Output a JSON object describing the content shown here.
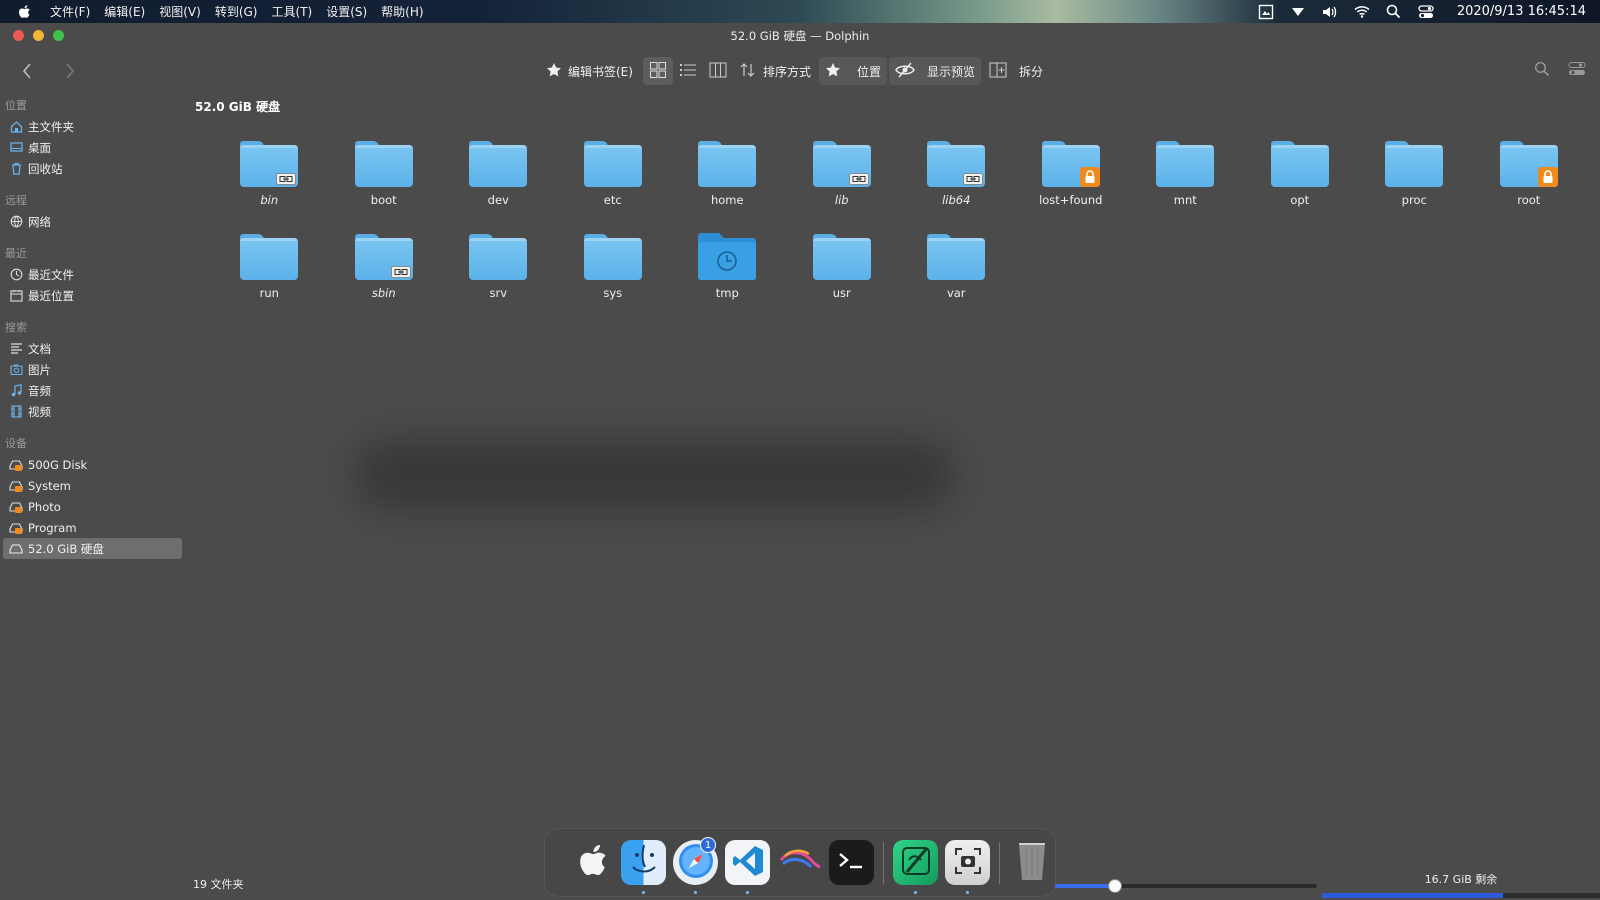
{
  "menubar": {
    "items": [
      "文件(F)",
      "编辑(E)",
      "视图(V)",
      "转到(G)",
      "工具(T)",
      "设置(S)",
      "帮助(H)"
    ],
    "clock": "2020/9/13  16:45:14",
    "tray_icons": [
      "screenshot-icon",
      "dropdown-icon",
      "volume-icon",
      "wifi-icon",
      "search-icon",
      "control-center-icon"
    ]
  },
  "window": {
    "title": "52.0 GiB 硬盘 — Dolphin"
  },
  "toolbar": {
    "edit_bookmark": "编辑书签(E)",
    "sort": "排序方式",
    "location": "位置",
    "preview": "显示预览",
    "split": "拆分"
  },
  "sidebar": {
    "sections": [
      {
        "label": "位置",
        "items": [
          {
            "label": "主文件夹",
            "icon": "home-icon"
          },
          {
            "label": "桌面",
            "icon": "desktop-icon"
          },
          {
            "label": "回收站",
            "icon": "trash-icon"
          }
        ]
      },
      {
        "label": "远程",
        "items": [
          {
            "label": "网络",
            "icon": "network-icon"
          }
        ]
      },
      {
        "label": "最近",
        "items": [
          {
            "label": "最近文件",
            "icon": "clock-icon"
          },
          {
            "label": "最近位置",
            "icon": "calendar-icon"
          }
        ]
      },
      {
        "label": "搜索",
        "items": [
          {
            "label": "文档",
            "icon": "document-icon"
          },
          {
            "label": "图片",
            "icon": "image-icon"
          },
          {
            "label": "音频",
            "icon": "music-icon"
          },
          {
            "label": "视频",
            "icon": "video-icon"
          }
        ]
      },
      {
        "label": "设备",
        "items": [
          {
            "label": "500G Disk",
            "icon": "drive-icon"
          },
          {
            "label": "System",
            "icon": "drive-icon"
          },
          {
            "label": "Photo",
            "icon": "drive-icon"
          },
          {
            "label": "Program",
            "icon": "drive-icon"
          },
          {
            "label": "52.0 GiB 硬盘",
            "icon": "drive-icon",
            "selected": true
          }
        ]
      }
    ]
  },
  "content": {
    "breadcrumb": "52.0 GiB 硬盘",
    "files": [
      {
        "name": "bin",
        "badge": "link"
      },
      {
        "name": "boot",
        "badge": ""
      },
      {
        "name": "dev",
        "badge": ""
      },
      {
        "name": "etc",
        "badge": ""
      },
      {
        "name": "home",
        "badge": ""
      },
      {
        "name": "lib",
        "badge": "link"
      },
      {
        "name": "lib64",
        "badge": "link"
      },
      {
        "name": "lost+found",
        "badge": "lock"
      },
      {
        "name": "mnt",
        "badge": ""
      },
      {
        "name": "opt",
        "badge": ""
      },
      {
        "name": "proc",
        "badge": ""
      },
      {
        "name": "root",
        "badge": "lock"
      },
      {
        "name": "run",
        "badge": ""
      },
      {
        "name": "sbin",
        "badge": "link"
      },
      {
        "name": "srv",
        "badge": ""
      },
      {
        "name": "sys",
        "badge": ""
      },
      {
        "name": "tmp",
        "badge": "tmp"
      },
      {
        "name": "usr",
        "badge": ""
      },
      {
        "name": "var",
        "badge": ""
      }
    ]
  },
  "status": {
    "count": "19 文件夹",
    "free_space": "16.7 GiB 剩余",
    "zoom_level": 0.23,
    "used_fraction": 0.65
  },
  "dock": {
    "items": [
      {
        "icon": "apple-icon",
        "running": false
      },
      {
        "icon": "finder-icon",
        "running": true
      },
      {
        "icon": "browser-icon",
        "running": true,
        "badge": "1"
      },
      {
        "icon": "vscode-icon",
        "running": true
      },
      {
        "icon": "kali-icon",
        "running": false
      },
      {
        "icon": "terminal-icon",
        "running": false
      },
      {
        "icon": "editor-icon",
        "running": true
      },
      {
        "icon": "screenshot-app-icon",
        "running": true
      },
      {
        "icon": "trash-icon",
        "running": false
      }
    ]
  }
}
